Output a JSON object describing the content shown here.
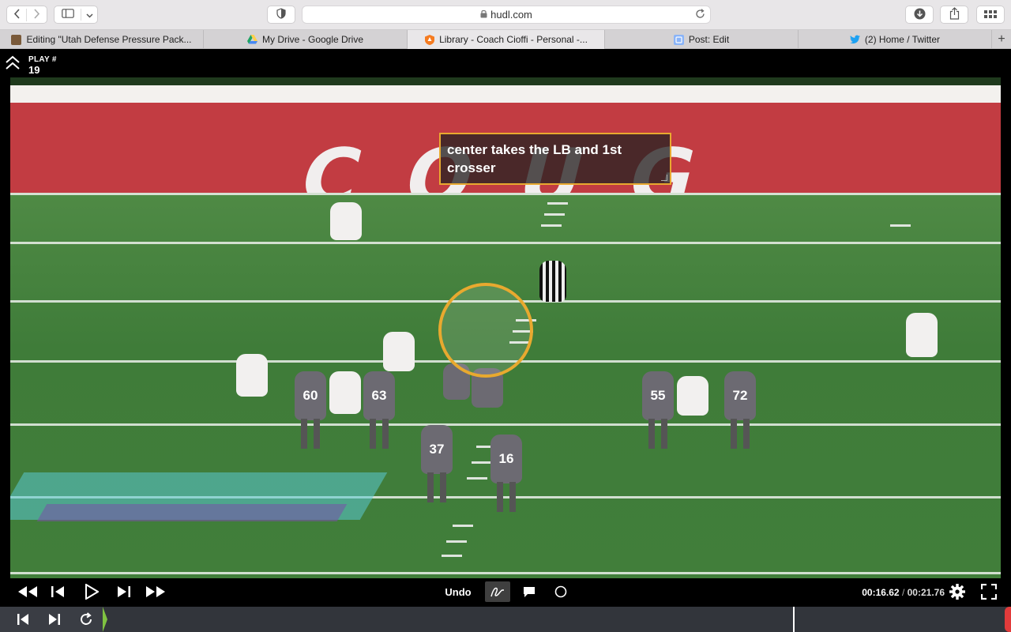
{
  "browser": {
    "url": "hudl.com",
    "tabs": [
      {
        "label": "Editing \"Utah Defense Pressure Pack...",
        "icon": "blogger-icon",
        "active": false
      },
      {
        "label": "My Drive - Google Drive",
        "icon": "google-drive-icon",
        "active": false
      },
      {
        "label": "Library - Coach Cioffi - Personal -...",
        "icon": "hudl-icon",
        "active": true
      },
      {
        "label": "Post: Edit",
        "icon": "blogger-post-icon",
        "active": false
      },
      {
        "label": "(2) Home / Twitter",
        "icon": "twitter-icon",
        "active": false
      }
    ],
    "colors": {
      "twitter": "#1da1f2",
      "hudl": "#f57b20",
      "drive_green": "#1fa463",
      "drive_yellow": "#ffd04b",
      "drive_blue": "#4688f4"
    }
  },
  "player": {
    "play_label": "PLAY #",
    "play_number": "19",
    "annotation_text": "center takes the LB and 1st crosser",
    "annotation_color": "#e8a92f",
    "jersey_numbers": [
      "60",
      "63",
      "37",
      "16",
      "55",
      "72"
    ]
  },
  "controls": {
    "undo_label": "Undo",
    "current_time": "00:16.62",
    "separator": "/",
    "duration": "00:21.76",
    "active_tool": "freehand-draw-icon",
    "playhead_progress": 0.76
  }
}
